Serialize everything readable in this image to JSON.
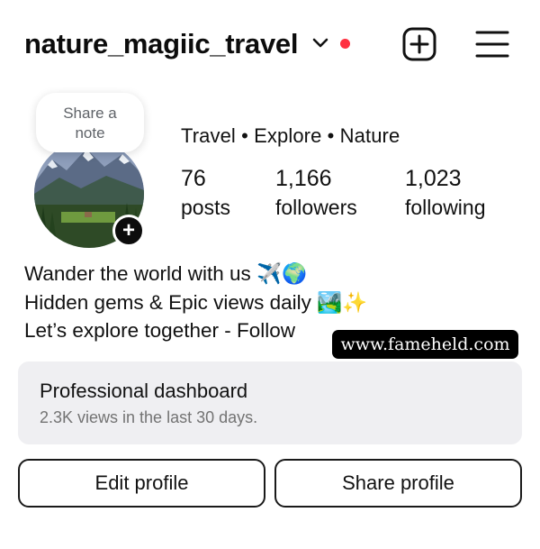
{
  "header": {
    "username": "nature_magiic_travel",
    "notification_color": "#ff3040",
    "icons": [
      "chevron-down-icon",
      "plus-square-icon",
      "hamburger-menu-icon"
    ]
  },
  "note": {
    "line1": "Share a",
    "line2": "note"
  },
  "avatar": {
    "add_icon": "+"
  },
  "profile": {
    "category": "Travel • Explore • Nature",
    "stats": [
      {
        "value": "76",
        "label": "posts"
      },
      {
        "value": "1,166",
        "label": "followers"
      },
      {
        "value": "1,023",
        "label": "following"
      }
    ],
    "bio": [
      "Wander the world with us ✈️🌍",
      "Hidden gems & Epic views daily 🏞️✨",
      "Let’s explore together - Follow"
    ]
  },
  "watermark": "www.fameheld.com",
  "dashboard": {
    "title": "Professional dashboard",
    "subtitle": "2.3K views in the last 30 days."
  },
  "buttons": {
    "edit": "Edit profile",
    "share": "Share profile"
  }
}
